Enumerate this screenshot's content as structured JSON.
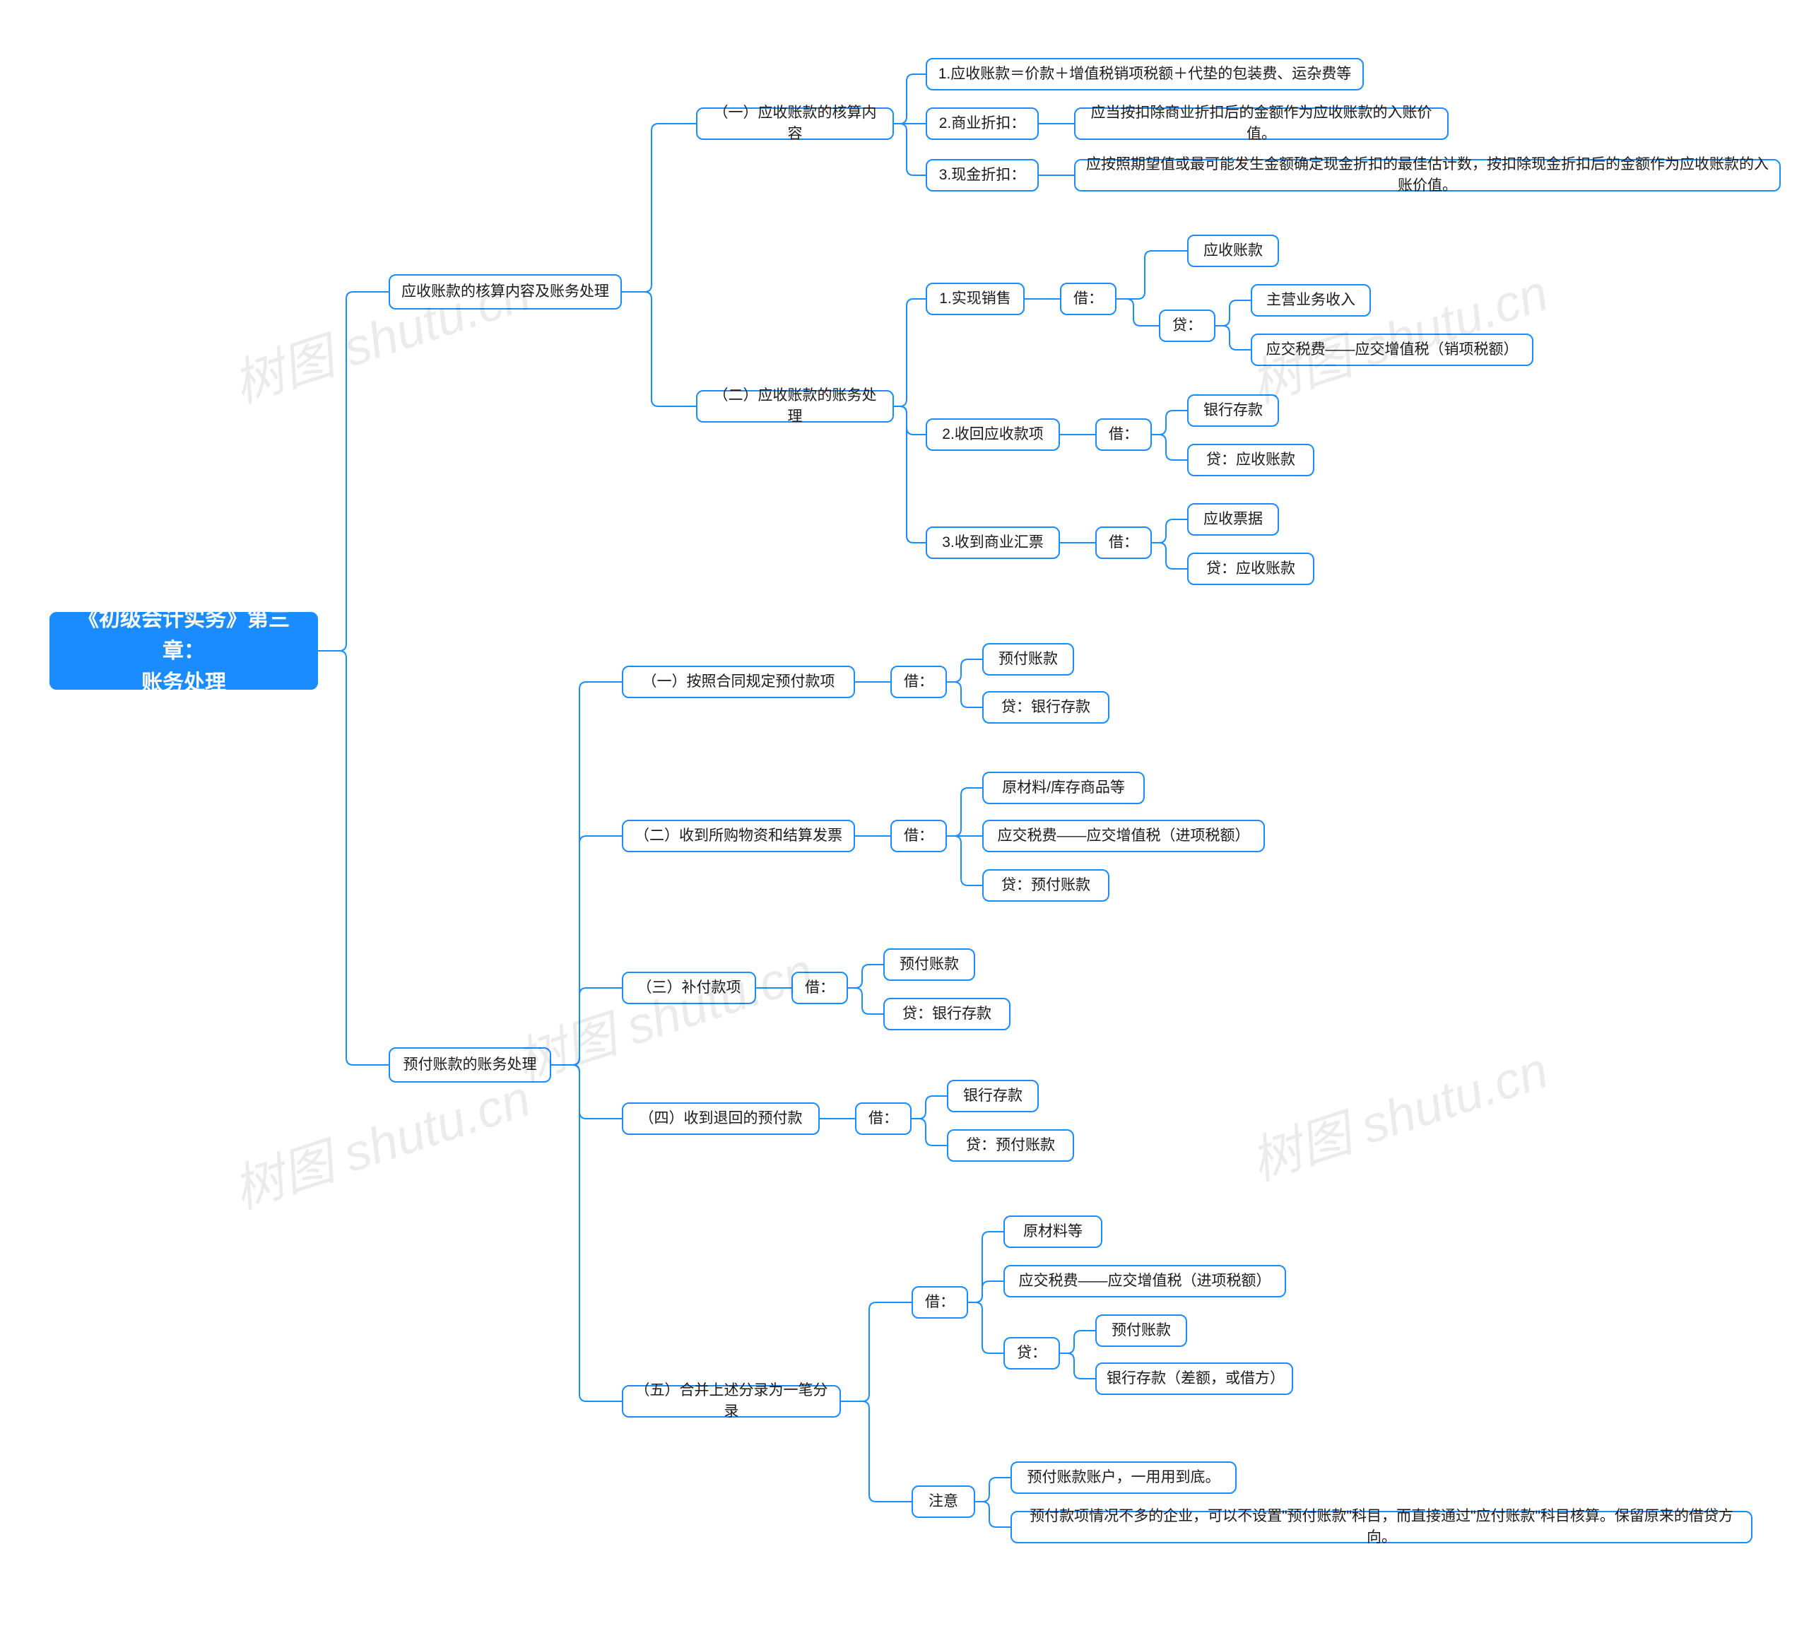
{
  "watermark": "树图 shutu.cn",
  "root": {
    "line1": "《初级会计实务》第三章：",
    "line2": "账务处理"
  },
  "s1": {
    "title": "应收账款的核算内容及账务处理",
    "a": {
      "title": "（一）应收账款的核算内容",
      "i1": "1.应收账款＝价款＋增值税销项税额＋代垫的包装费、运杂费等",
      "i2": "2.商业折扣：",
      "i2d": "应当按扣除商业折扣后的金额作为应收账款的入账价值。",
      "i3": "3.现金折扣：",
      "i3d": "应按照期望值或最可能发生金额确定现金折扣的最佳估计数，按扣除现金折扣后的金额作为应收账款的入账价值。"
    },
    "b": {
      "title": "（二）应收账款的账务处理",
      "p1": {
        "t": "1.实现销售",
        "dr": "借：",
        "drn": "应收账款",
        "cr": "贷：",
        "crn1": "主营业务收入",
        "crn2": "应交税费——应交增值税（销项税额）"
      },
      "p2": {
        "t": "2.收回应收款项",
        "dr": "借：",
        "drn": "银行存款",
        "crn": "贷：应收账款"
      },
      "p3": {
        "t": "3.收到商业汇票",
        "dr": "借：",
        "drn": "应收票据",
        "crn": "贷：应收账款"
      }
    }
  },
  "s2": {
    "title": "预付账款的账务处理",
    "a": {
      "t": "（一）按照合同规定预付款项",
      "dr": "借：",
      "drn": "预付账款",
      "crn": "贷：银行存款"
    },
    "b": {
      "t": "（二）收到所购物资和结算发票",
      "dr": "借：",
      "drn1": "原材料/库存商品等",
      "drn2": "应交税费——应交增值税（进项税额）",
      "crn": "贷：预付账款"
    },
    "c": {
      "t": "（三）补付款项",
      "dr": "借：",
      "drn": "预付账款",
      "crn": "贷：银行存款"
    },
    "d": {
      "t": "（四）收到退回的预付款",
      "dr": "借：",
      "drn": "银行存款",
      "crn": "贷：预付账款"
    },
    "e": {
      "t": "（五）合并上述分录为一笔分录",
      "dr": "借：",
      "drn1": "原材料等",
      "drn2": "应交税费——应交增值税（进项税额）",
      "cr": "贷：",
      "crn1": "预付账款",
      "crn2": "银行存款（差额，或借方）",
      "note": "注意",
      "noten1": "预付账款账户，一用用到底。",
      "noten2": "预付款项情况不多的企业，可以不设置\"预付账款\"科目，而直接通过\"应付账款\"科目核算。保留原来的借贷方向。"
    }
  }
}
